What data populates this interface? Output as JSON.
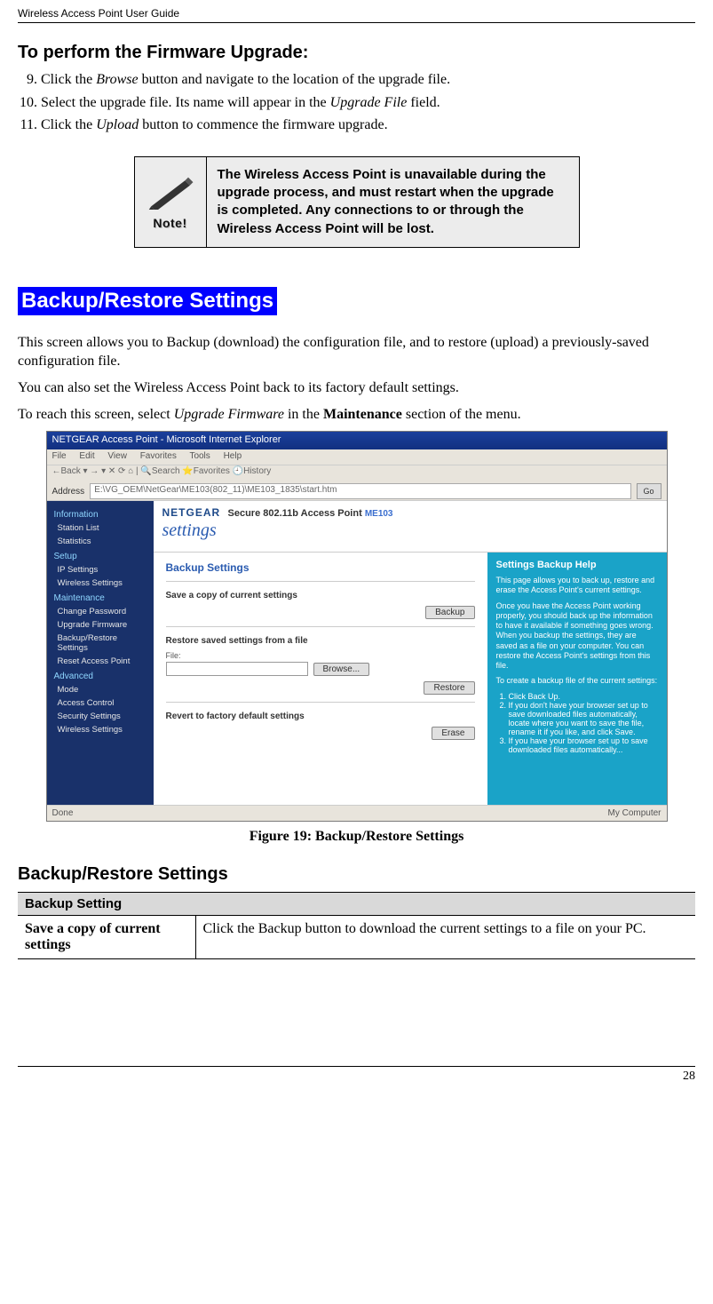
{
  "header": "Wireless Access Point User Guide",
  "page_number": "28",
  "heading_perform": "To perform the Firmware Upgrade:",
  "steps": {
    "s9_pre": "Click the ",
    "s9_i": "Browse",
    "s9_post": " button and navigate to the location of the upgrade file.",
    "s10_pre": "Select the upgrade file. Its name will appear in the ",
    "s10_i": "Upgrade File",
    "s10_post": " field.",
    "s11_pre": "Click the ",
    "s11_i": "Upload",
    "s11_post": " button to commence the firmware upgrade."
  },
  "note": {
    "label": "Note!",
    "text": "The Wireless Access Point is unavailable during the upgrade process, and must restart when the upgrade is completed. Any connections to or through the Wireless Access Point will be lost."
  },
  "section_title": "Backup/Restore Settings",
  "para1": "This screen allows you to Backup (download) the configuration file, and to restore (upload) a previously-saved configuration file.",
  "para2": "You can also set the Wireless Access Point back to its factory default settings.",
  "para3_pre": "To reach this screen, select ",
  "para3_i": "Upgrade Firmware",
  "para3_mid": " in the ",
  "para3_b": "Maintenance",
  "para3_post": " section of the menu.",
  "figure": {
    "titlebar": "NETGEAR Access Point - Microsoft Internet Explorer",
    "menu": {
      "file": "File",
      "edit": "Edit",
      "view": "View",
      "fav": "Favorites",
      "tools": "Tools",
      "help": "Help"
    },
    "toolitems": "←Back  ▾  →  ▾  ✕  ⟳  ⌂  | 🔍Search  ⭐Favorites  🕘History",
    "address_label": "Address",
    "address": "E:\\VG_OEM\\NetGear\\ME103(802_11)\\ME103_1835\\start.htm",
    "go": "Go",
    "brand": {
      "ng": "NETGEAR",
      "prod_pre": "Secure 802.11b Access Point ",
      "model": "ME103",
      "settings": "settings"
    },
    "sidebar": {
      "info_hdr": "Information",
      "info1": "Station List",
      "info2": "Statistics",
      "setup_hdr": "Setup",
      "setup1": "IP Settings",
      "setup2": "Wireless Settings",
      "maint_hdr": "Maintenance",
      "maint1": "Change Password",
      "maint2": "Upgrade Firmware",
      "maint3": "Backup/Restore Settings",
      "maint4": "Reset Access Point",
      "adv_hdr": "Advanced",
      "adv1": "Mode",
      "adv2": "Access Control",
      "adv3": "Security Settings",
      "adv4": "Wireless Settings"
    },
    "content": {
      "title": "Backup Settings",
      "save_lbl": "Save a copy of current settings",
      "backup_btn": "Backup",
      "restore_lbl": "Restore saved settings from a file",
      "file_lbl": "File:",
      "browse_btn": "Browse...",
      "restore_btn": "Restore",
      "revert_lbl": "Revert to factory default settings",
      "erase_btn": "Erase"
    },
    "help": {
      "title": "Settings Backup Help",
      "p1": "This page allows you to back up, restore and erase the Access Point's current settings.",
      "p2": "Once you have the Access Point working properly, you should back up the information to have it available if something goes wrong. When you backup the settings, they are saved as a file on your computer. You can restore the Access Point's settings from this file.",
      "p3": "To create a backup file of the current settings:",
      "li1": "Click Back Up.",
      "li2": "If you don't have your browser set up to save downloaded files automatically, locate where you want to save the file, rename it if you like, and click Save.",
      "li3": "If you have your browser set up to save downloaded files automatically..."
    },
    "status_left": "Done",
    "status_right": "My Computer"
  },
  "figure_caption": "Figure 19: Backup/Restore Settings",
  "subheading": "Backup/Restore Settings",
  "table": {
    "header": "Backup Setting",
    "row1_left": "Save a copy of current settings",
    "row1_right": "Click the Backup button to download the current settings to a file on your PC."
  }
}
